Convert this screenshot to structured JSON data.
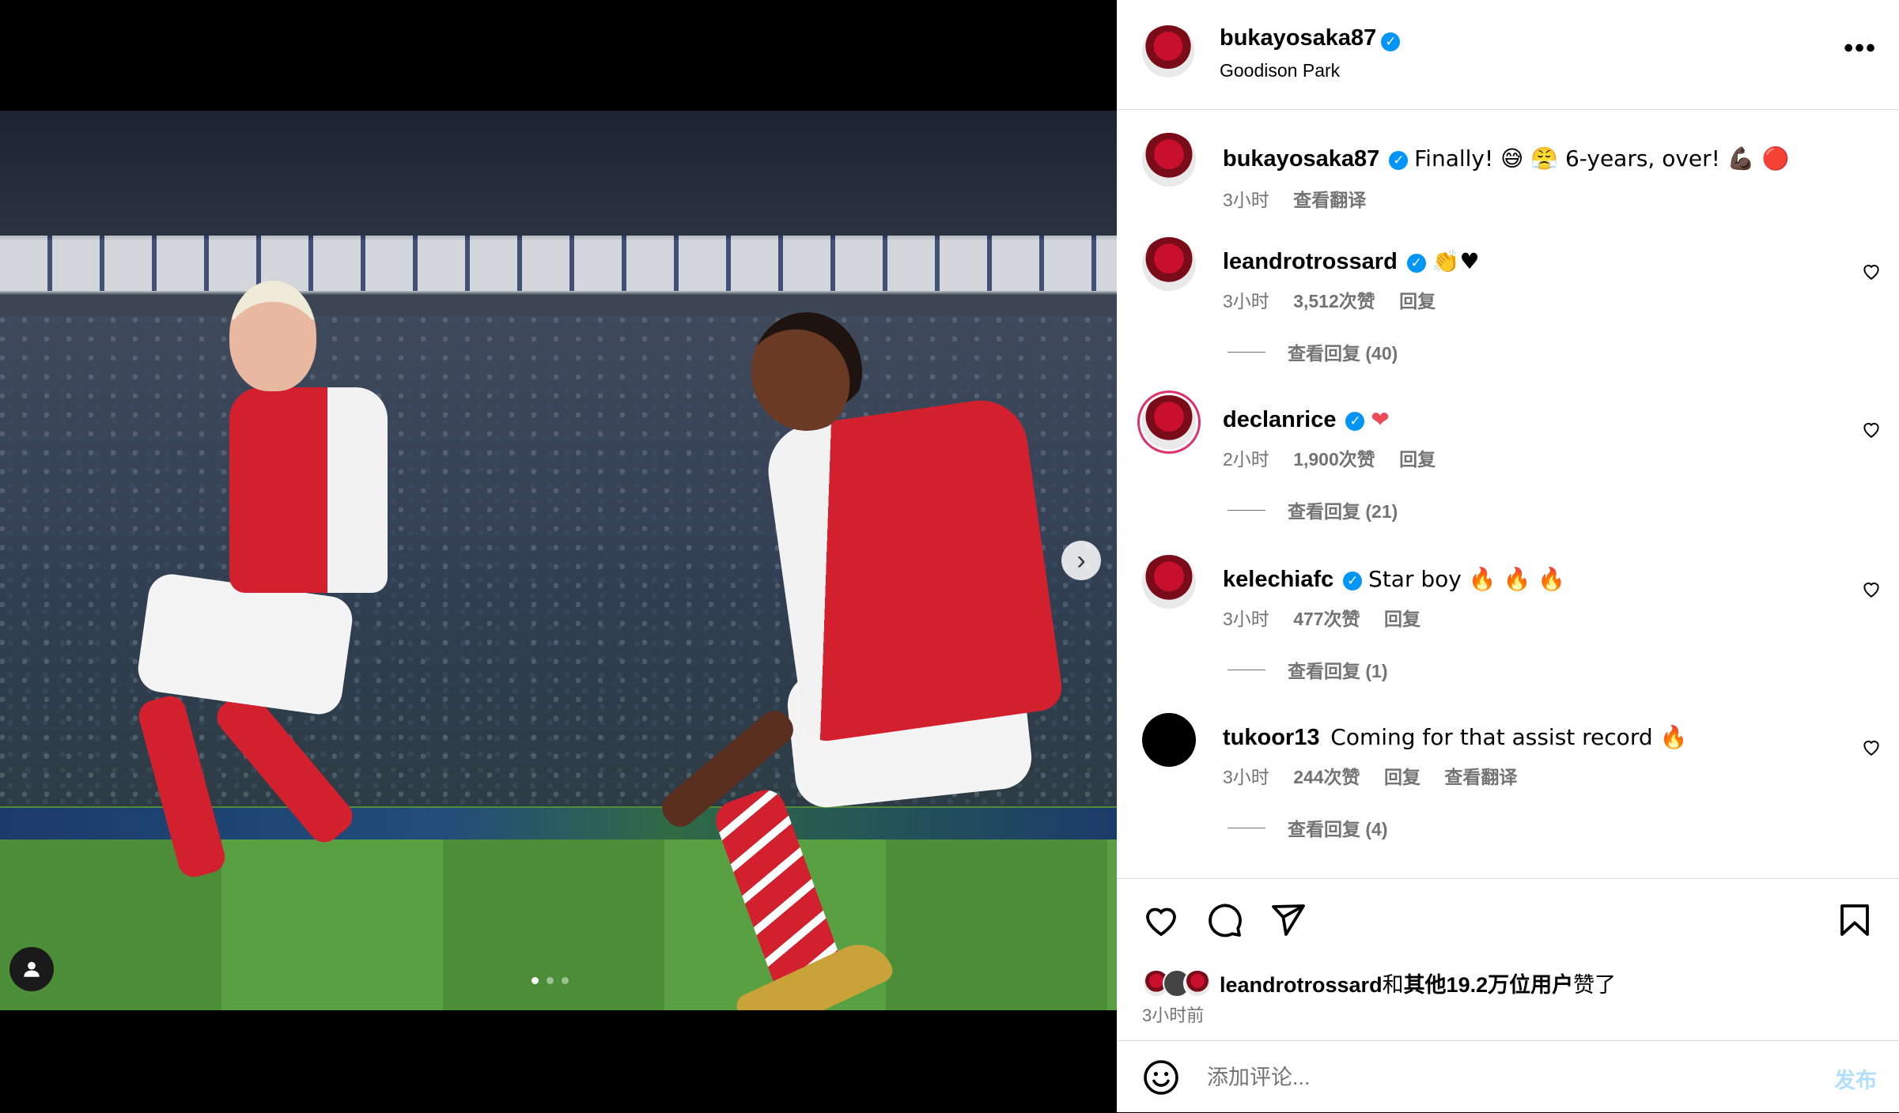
{
  "post": {
    "username": "bukayosaka87",
    "location": "Goodison Park",
    "caption_text": "Finally! 😅 😤 6-years, over! 💪🏿 🔴",
    "caption_time": "3小时",
    "caption_translate": "查看翻译",
    "image_alt": "Two Arsenal players celebrating",
    "carousel_dots": 3,
    "carousel_index": 0
  },
  "comments": [
    {
      "username": "leandrotrossard",
      "verified": true,
      "text": "👏♥",
      "time": "3小时",
      "likes": "3,512次赞",
      "reply": "回复",
      "view_replies": "查看回复 (40)"
    },
    {
      "username": "declanrice",
      "verified": true,
      "text": "❤",
      "time": "2小时",
      "likes": "1,900次赞",
      "reply": "回复",
      "view_replies": "查看回复 (21)"
    },
    {
      "username": "kelechiafc",
      "verified": true,
      "text": "Star boy 🔥 🔥 🔥",
      "time": "3小时",
      "likes": "477次赞",
      "reply": "回复",
      "view_replies": "查看回复 (1)"
    },
    {
      "username": "tukoor13",
      "verified": false,
      "text": "Coming for that assist record 🔥",
      "time": "3小时",
      "likes": "244次赞",
      "reply": "回复",
      "translate": "查看翻译",
      "view_replies": "查看回复 (4)"
    }
  ],
  "likes": {
    "liker": "leandrotrossard",
    "connector": "和",
    "others": "其他19.2万位用户",
    "suffix": "赞了"
  },
  "posted_time": "3小时前",
  "add_comment": {
    "placeholder": "添加评论...",
    "post_label": "发布"
  },
  "colors": {
    "verified": "#0095f6",
    "like_red": "#ed4956",
    "muted": "#737373",
    "post_button_disabled": "#b2dffc",
    "arsenal_red": "#d3202e"
  },
  "icons": {
    "more": "more-options-icon",
    "next": "chevron-right-icon",
    "tag": "user-tag-icon",
    "like": "heart-icon",
    "comment": "comment-icon",
    "share": "send-icon",
    "save": "bookmark-icon",
    "emoji": "emoji-icon"
  }
}
